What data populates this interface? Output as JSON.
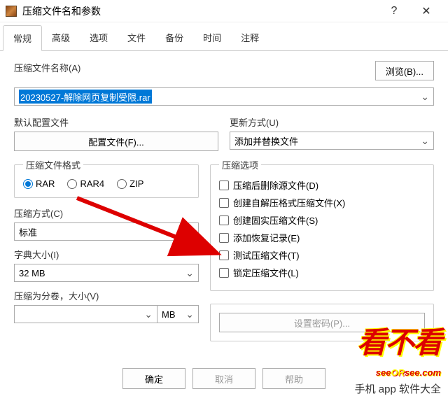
{
  "window": {
    "title": "压缩文件名和参数"
  },
  "tabs": [
    "常规",
    "高级",
    "选项",
    "文件",
    "备份",
    "时间",
    "注释"
  ],
  "archive_name": {
    "label": "压缩文件名称(A)",
    "value": "20230527-解除网页复制受限.rar",
    "browse": "浏览(B)..."
  },
  "profile": {
    "label": "默认配置文件",
    "button": "配置文件(F)..."
  },
  "update": {
    "label": "更新方式(U)",
    "value": "添加并替换文件"
  },
  "format": {
    "legend": "压缩文件格式",
    "rar": "RAR",
    "rar4": "RAR4",
    "zip": "ZIP"
  },
  "options": {
    "legend": "压缩选项",
    "items": [
      "压缩后删除源文件(D)",
      "创建自解压格式压缩文件(X)",
      "创建固实压缩文件(S)",
      "添加恢复记录(E)",
      "测试压缩文件(T)",
      "锁定压缩文件(L)"
    ]
  },
  "method": {
    "label": "压缩方式(C)",
    "value": "标准"
  },
  "dict": {
    "label": "字典大小(I)",
    "value": "32 MB"
  },
  "volume": {
    "label": "压缩为分卷，大小(V)",
    "unit": "MB"
  },
  "password_btn": "设置密码(P)...",
  "footer": {
    "ok": "确定",
    "cancel": "取消",
    "help": "帮助"
  },
  "overlay": {
    "l1": "看不看",
    "l2a": "see",
    "l2b": "OR",
    "l2c": "see",
    "l2d": ".com",
    "l3": "手机 app 软件大全"
  }
}
